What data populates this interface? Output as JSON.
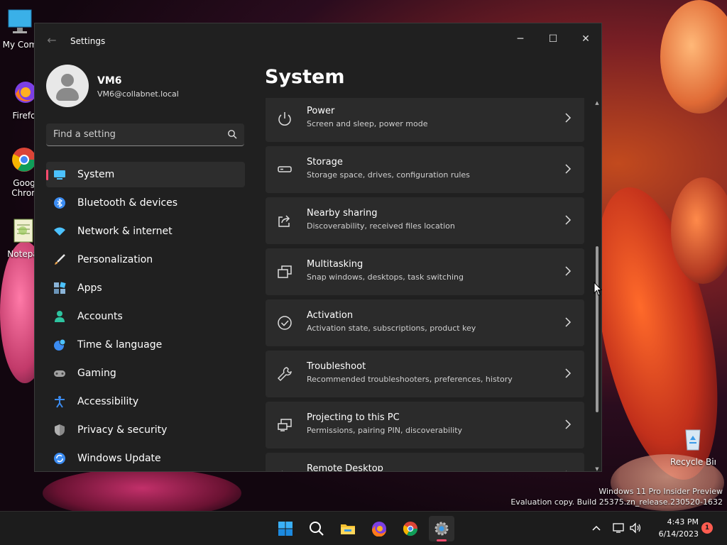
{
  "desktop": {
    "icons": [
      {
        "label": "My Com",
        "icon": "computer-icon"
      },
      {
        "label": "Firefo",
        "icon": "firefox-icon"
      },
      {
        "label": "Goog",
        "label2": "Chron",
        "icon": "chrome-icon"
      },
      {
        "label": "Notepa",
        "icon": "notepad-icon"
      }
    ],
    "recycle_bin": {
      "label": "Recycle Bin",
      "icon": "recycle-bin-icon"
    },
    "watermark": {
      "line1": "Windows 11 Pro Insider Preview",
      "line2": "Evaluation copy. Build 25375.zn_release.230520-1632"
    }
  },
  "window": {
    "title": "Settings",
    "back_icon": "back-arrow-icon",
    "controls": {
      "minimize": "─",
      "maximize": "☐",
      "close": "✕"
    },
    "profile": {
      "name": "VM6",
      "email": "VM6@collabnet.local"
    },
    "search": {
      "placeholder": "Find a setting",
      "icon": "search-icon"
    },
    "nav": [
      {
        "label": "System",
        "icon": "system-icon",
        "active": true,
        "color": "#4cc2ff"
      },
      {
        "label": "Bluetooth & devices",
        "icon": "bluetooth-icon",
        "color": "#3b8cf2"
      },
      {
        "label": "Network & internet",
        "icon": "wifi-icon",
        "color": "#4cc2ff"
      },
      {
        "label": "Personalization",
        "icon": "brush-icon",
        "color": "#e8a04c"
      },
      {
        "label": "Apps",
        "icon": "apps-icon",
        "color": "#8ab4d8"
      },
      {
        "label": "Accounts",
        "icon": "accounts-icon",
        "color": "#2ec4a0"
      },
      {
        "label": "Time & language",
        "icon": "globe-clock-icon",
        "color": "#4cc2ff"
      },
      {
        "label": "Gaming",
        "icon": "gamepad-icon",
        "color": "#a0a0a0"
      },
      {
        "label": "Accessibility",
        "icon": "accessibility-icon",
        "color": "#3b8cf2"
      },
      {
        "label": "Privacy & security",
        "icon": "shield-icon",
        "color": "#8a8a8a"
      },
      {
        "label": "Windows Update",
        "icon": "update-icon",
        "color": "#4cc2ff"
      }
    ],
    "content": {
      "title": "System",
      "items": [
        {
          "title": "Power",
          "subtitle": "Screen and sleep, power mode",
          "icon": "power-icon"
        },
        {
          "title": "Storage",
          "subtitle": "Storage space, drives, configuration rules",
          "icon": "storage-icon"
        },
        {
          "title": "Nearby sharing",
          "subtitle": "Discoverability, received files location",
          "icon": "share-icon"
        },
        {
          "title": "Multitasking",
          "subtitle": "Snap windows, desktops, task switching",
          "icon": "multitasking-icon"
        },
        {
          "title": "Activation",
          "subtitle": "Activation state, subscriptions, product key",
          "icon": "activation-icon"
        },
        {
          "title": "Troubleshoot",
          "subtitle": "Recommended troubleshooters, preferences, history",
          "icon": "wrench-icon"
        },
        {
          "title": "Projecting to this PC",
          "subtitle": "Permissions, pairing PIN, discoverability",
          "icon": "projecting-icon"
        },
        {
          "title": "Remote Desktop",
          "subtitle": "",
          "icon": "remote-desktop-icon"
        }
      ]
    }
  },
  "taskbar": {
    "apps": [
      {
        "name": "Start",
        "icon": "windows-start-icon"
      },
      {
        "name": "Search",
        "icon": "search-icon"
      },
      {
        "name": "File Explorer",
        "icon": "folder-icon"
      },
      {
        "name": "Firefox",
        "icon": "firefox-icon"
      },
      {
        "name": "Chrome",
        "icon": "chrome-icon"
      },
      {
        "name": "Settings",
        "icon": "settings-gear-icon",
        "active": true
      }
    ],
    "tray": {
      "time": "4:43 PM",
      "date": "6/14/2023",
      "notifications": "1"
    },
    "accent": "#ff4b6e"
  }
}
